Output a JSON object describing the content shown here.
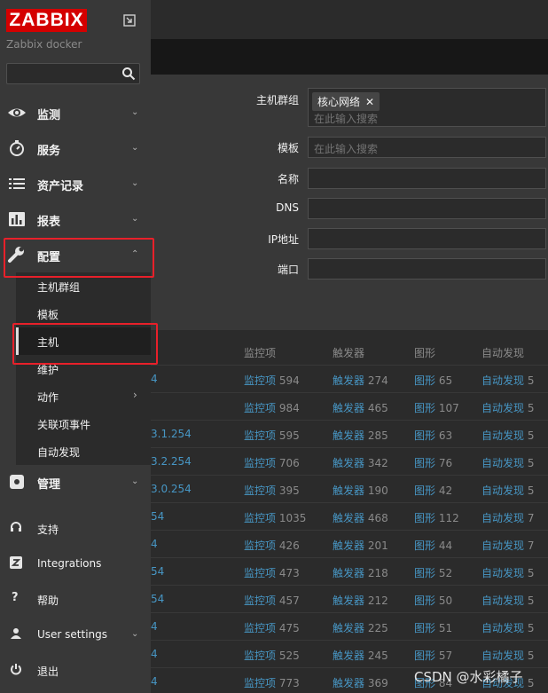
{
  "app": {
    "logo_text": "ZABBIX",
    "server_name": "Zabbix docker"
  },
  "sidebar": {
    "menu": [
      {
        "label": "监测",
        "icon": "eye-icon"
      },
      {
        "label": "服务",
        "icon": "stopwatch-icon"
      },
      {
        "label": "资产记录",
        "icon": "list-icon"
      },
      {
        "label": "报表",
        "icon": "bar-chart-icon"
      },
      {
        "label": "配置",
        "icon": "wrench-icon"
      }
    ],
    "config_sub": [
      {
        "label": "主机群组"
      },
      {
        "label": "模板"
      },
      {
        "label": "主机"
      },
      {
        "label": "维护"
      },
      {
        "label": "动作"
      },
      {
        "label": "关联项事件"
      },
      {
        "label": "自动发现"
      }
    ],
    "admin": {
      "label": "管理"
    },
    "bottom": [
      {
        "label": "支持",
        "icon": "headset-icon"
      },
      {
        "label": "Integrations",
        "icon": "zabbix-z-icon"
      },
      {
        "label": "帮助",
        "icon": "question-icon"
      },
      {
        "label": "User settings",
        "icon": "user-icon"
      },
      {
        "label": "退出",
        "icon": "power-icon"
      }
    ]
  },
  "filter": {
    "host_groups_label": "主机群组",
    "host_group_chip": "核心网络",
    "host_groups_placeholder": "在此输入搜索",
    "templates_label": "模板",
    "templates_placeholder": "在此输入搜索",
    "name_label": "名称",
    "dns_label": "DNS",
    "ip_label": "IP地址",
    "port_label": "端口"
  },
  "table": {
    "headers": [
      "监控项",
      "触发器",
      "图形",
      "自动发现"
    ],
    "rows": [
      {
        "frag": "4",
        "items": "594",
        "triggers": "274",
        "graphs": "65",
        "disc": "5"
      },
      {
        "frag": "",
        "items": "984",
        "triggers": "465",
        "graphs": "107",
        "disc": "5"
      },
      {
        "frag": "3.1.254",
        "items": "595",
        "triggers": "285",
        "graphs": "63",
        "disc": "5"
      },
      {
        "frag": "3.2.254",
        "items": "706",
        "triggers": "342",
        "graphs": "76",
        "disc": "5"
      },
      {
        "frag": "3.0.254",
        "items": "395",
        "triggers": "190",
        "graphs": "42",
        "disc": "5"
      },
      {
        "frag": "54",
        "items": "1035",
        "triggers": "468",
        "graphs": "112",
        "disc": "7"
      },
      {
        "frag": "4",
        "items": "426",
        "triggers": "201",
        "graphs": "44",
        "disc": "7"
      },
      {
        "frag": "54",
        "items": "473",
        "triggers": "218",
        "graphs": "52",
        "disc": "5"
      },
      {
        "frag": "54",
        "items": "457",
        "triggers": "212",
        "graphs": "50",
        "disc": "5"
      },
      {
        "frag": "4",
        "items": "475",
        "triggers": "225",
        "graphs": "51",
        "disc": "5"
      },
      {
        "frag": "4",
        "items": "525",
        "triggers": "245",
        "graphs": "57",
        "disc": "5"
      },
      {
        "frag": "4",
        "items": "773",
        "triggers": "369",
        "graphs": "84",
        "disc": "5"
      }
    ],
    "link_items": "监控项",
    "link_triggers": "触发器",
    "link_graphs": "图形",
    "link_disc": "自动发现"
  },
  "watermark": "CSDN @水彩橘子",
  "colors": {
    "accent_red": "#d40000",
    "link": "#4796c4",
    "highlight_box": "#e8202a"
  }
}
